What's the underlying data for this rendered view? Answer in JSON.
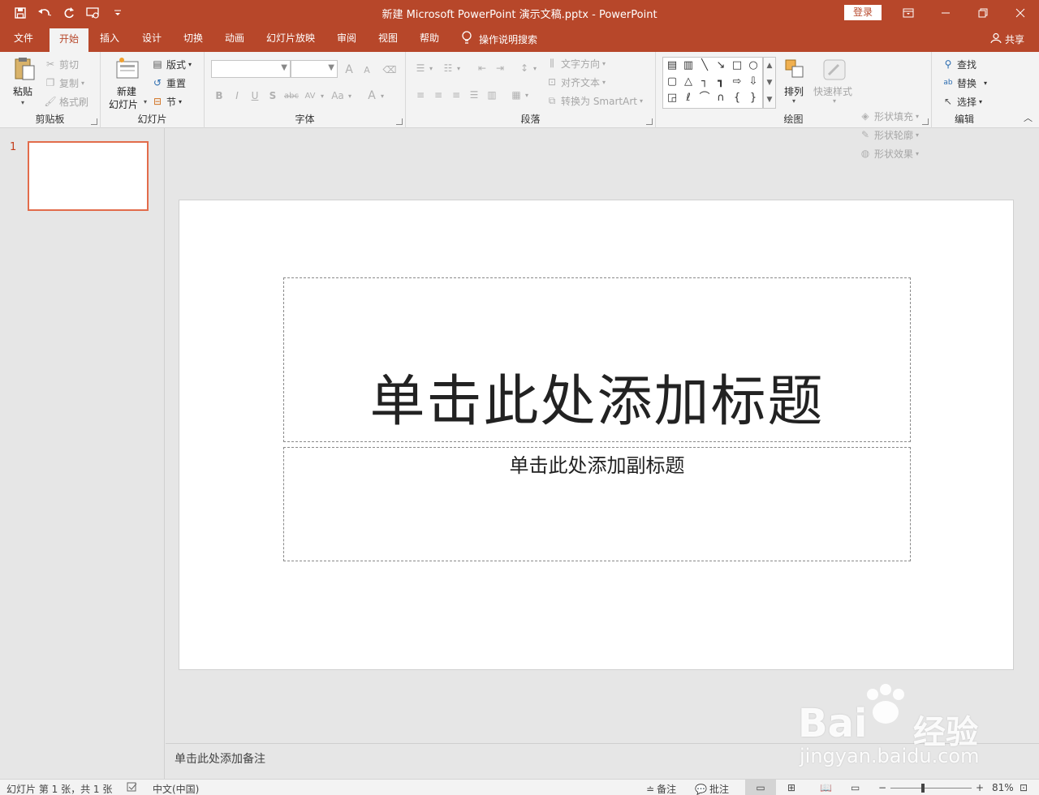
{
  "window": {
    "title": "新建 Microsoft PowerPoint 演示文稿.pptx - PowerPoint",
    "login_label": "登录",
    "controls": [
      "ribbon-display-icon",
      "minimize-icon",
      "restore-icon",
      "close-icon"
    ]
  },
  "qat": {
    "icons": [
      "save-icon",
      "undo-icon",
      "redo-icon",
      "present-from-start-icon",
      "customize-qat-icon"
    ]
  },
  "tabs": [
    {
      "label": "文件"
    },
    {
      "label": "开始"
    },
    {
      "label": "插入"
    },
    {
      "label": "设计"
    },
    {
      "label": "切换"
    },
    {
      "label": "动画"
    },
    {
      "label": "幻灯片放映"
    },
    {
      "label": "审阅"
    },
    {
      "label": "视图"
    },
    {
      "label": "帮助"
    }
  ],
  "active_tab": "开始",
  "tellme": "操作说明搜索",
  "share": "共享",
  "ribbon": {
    "clipboard": {
      "label": "剪贴板",
      "paste": "粘贴",
      "cut": "剪切",
      "copy": "复制",
      "format_painter": "格式刷"
    },
    "slides": {
      "label": "幻灯片",
      "new_slide_line1": "新建",
      "new_slide_line2": "幻灯片",
      "layout": "版式",
      "reset": "重置",
      "section": "节"
    },
    "font": {
      "label": "字体",
      "bold": "B",
      "italic": "I",
      "underline": "U",
      "shadow": "S",
      "strike": "abc",
      "spacing": "AV",
      "case": "Aa",
      "grow": "A",
      "shrink": "A",
      "color": "A"
    },
    "paragraph": {
      "label": "段落",
      "text_direction": "文字方向",
      "align_text": "对齐文本",
      "smartart": "转换为 SmartArt"
    },
    "drawing": {
      "label": "绘图",
      "arrange": "排列",
      "quick_styles": "快速样式",
      "shape_fill": "形状填充",
      "shape_outline": "形状轮廓",
      "shape_effects": "形状效果"
    },
    "editing": {
      "label": "编辑",
      "find": "查找",
      "replace": "替换",
      "select": "选择"
    }
  },
  "thumbnails": [
    {
      "number": "1"
    }
  ],
  "slide": {
    "title_placeholder": "单击此处添加标题",
    "subtitle_placeholder": "单击此处添加副标题"
  },
  "notes_placeholder": "单击此处添加备注",
  "status": {
    "slide_info": "幻灯片 第 1 张，共 1 张",
    "language": "中文(中国)",
    "notes": "备注",
    "comments": "批注",
    "zoom": "81%"
  },
  "watermark": {
    "brand": "Bai",
    "brand_cn": "经验",
    "url": "jingyan.baidu.com"
  }
}
